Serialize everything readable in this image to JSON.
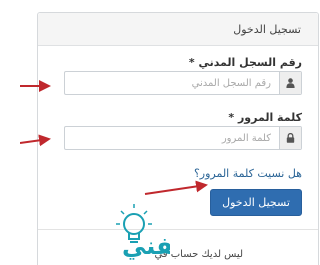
{
  "panel": {
    "title": "تسجيل الدخول"
  },
  "form": {
    "civil_id": {
      "label": "رقم السجل المدني *",
      "placeholder": "رقم السجل المدني",
      "icon": "user-icon"
    },
    "password": {
      "label": "كلمة المرور *",
      "placeholder": "كلمة المرور",
      "icon": "lock-icon"
    },
    "forgot_link": "هل نسيت كلمة المرور؟",
    "submit_label": "تسجيل الدخول"
  },
  "footer": {
    "text": "ليس لديك حساب في"
  },
  "watermark": {
    "text": "ثقفني",
    "icon": "lightbulb-icon"
  },
  "colors": {
    "accent": "#2f6db0",
    "arrow": "#c0282d",
    "link": "#2a6496",
    "watermark": "#1aa0b3"
  }
}
